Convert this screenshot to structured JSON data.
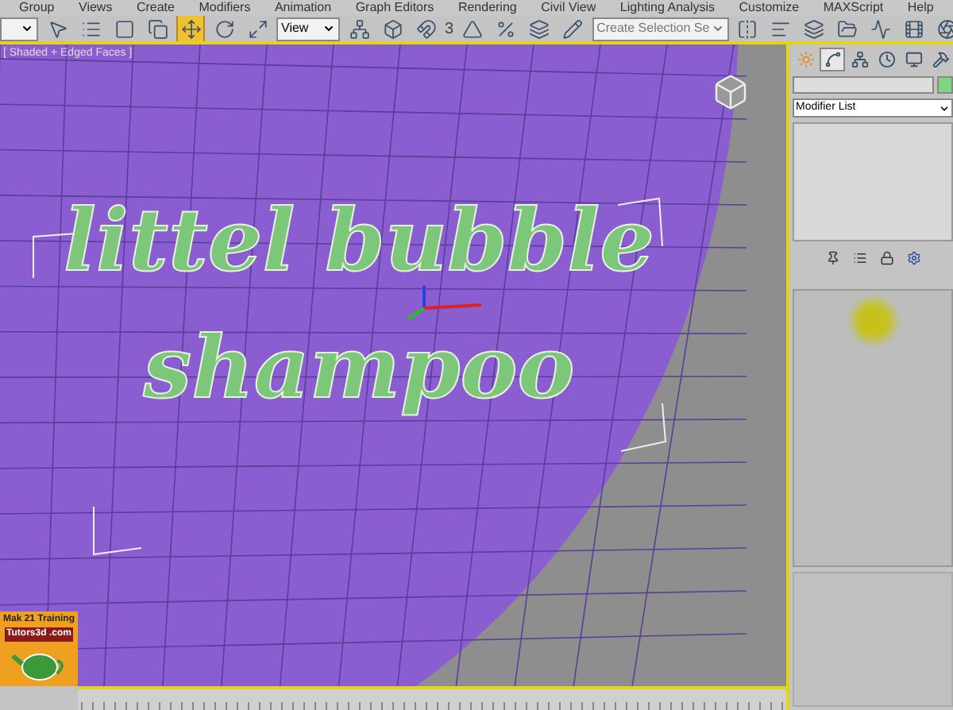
{
  "menu_bar": [
    "Group",
    "Views",
    "Create",
    "Modifiers",
    "Animation",
    "Graph Editors",
    "Rendering",
    "Civil View",
    "Lighting Analysis",
    "Customize",
    "MAXScript",
    "Help"
  ],
  "toolbar": [
    {
      "kind": "dropdown"
    },
    {
      "kind": "button",
      "active": false
    },
    {
      "kind": "button",
      "active": false
    },
    {
      "kind": "button",
      "active": false
    },
    {
      "kind": "button",
      "active": false
    },
    {
      "kind": "button",
      "active": true
    },
    {
      "kind": "button",
      "active": false
    },
    {
      "kind": "button",
      "active": false
    },
    {
      "kind": "dropdown",
      "value": "View"
    },
    {
      "kind": "button",
      "active": false
    },
    {
      "kind": "button",
      "active": false
    },
    {
      "kind": "button",
      "active": false
    },
    {
      "kind": "text",
      "value": "3"
    },
    {
      "kind": "button",
      "active": false
    },
    {
      "kind": "button",
      "active": false
    },
    {
      "kind": "button",
      "active": false
    },
    {
      "kind": "button",
      "active": false
    },
    {
      "kind": "dropdown",
      "value": "Create Selection Se"
    },
    {
      "kind": "button",
      "active": false
    },
    {
      "kind": "button",
      "active": false
    },
    {
      "kind": "button",
      "active": false
    },
    {
      "kind": "button",
      "active": false
    },
    {
      "kind": "button",
      "active": false
    },
    {
      "kind": "button",
      "active": false
    },
    {
      "kind": "button",
      "active": false
    }
  ],
  "viewport": {
    "label": "[ Shaded + Edged Faces ]",
    "text_lines": [
      "littel bubble",
      "shampoo"
    ]
  },
  "command_panel": {
    "tabs": [
      {
        "selected": false
      },
      {
        "selected": true
      },
      {
        "selected": false
      },
      {
        "selected": false
      },
      {
        "selected": false
      },
      {
        "selected": false
      }
    ],
    "modifier_list": "Modifier List"
  },
  "logo": {
    "line_1": "Mak 21 Training",
    "line_2": "Tutors3d .com"
  }
}
